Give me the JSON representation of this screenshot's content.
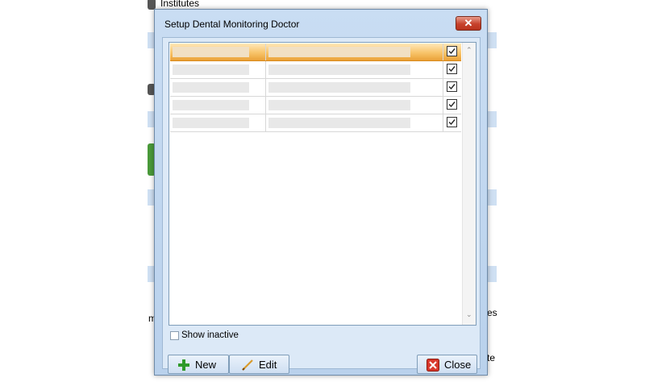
{
  "background": {
    "top_label": "Institutes",
    "right_fragment_1": "es",
    "right_fragment_2": "te",
    "left_fragment": "m"
  },
  "dialog": {
    "title": "Setup Dental Monitoring Doctor",
    "close_glyph": "✕"
  },
  "grid": {
    "rows": [
      {
        "col1": "",
        "col2": "",
        "active": true,
        "selected": true
      },
      {
        "col1": "",
        "col2": "",
        "active": true,
        "selected": false
      },
      {
        "col1": "",
        "col2": "",
        "active": true,
        "selected": false
      },
      {
        "col1": "",
        "col2": "",
        "active": true,
        "selected": false
      },
      {
        "col1": "",
        "col2": "",
        "active": true,
        "selected": false
      }
    ],
    "scroll_up_glyph": "⌃",
    "scroll_down_glyph": "⌄"
  },
  "controls": {
    "show_inactive_label": "Show inactive",
    "show_inactive_checked": false,
    "new_label": "New",
    "edit_label": "Edit",
    "close_label": "Close"
  },
  "icons": {
    "new": "plus-icon",
    "edit": "pencil-icon",
    "close": "close-icon"
  }
}
